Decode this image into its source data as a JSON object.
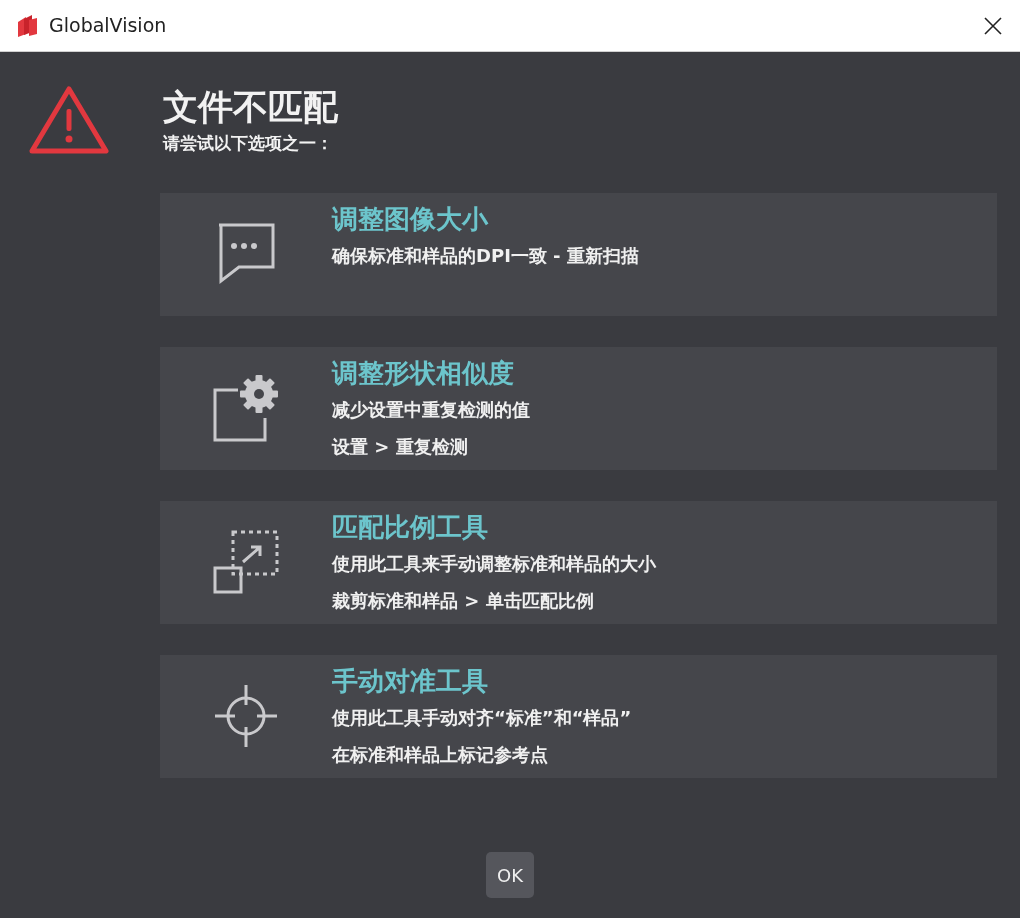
{
  "window": {
    "title": "GlobalVision"
  },
  "header": {
    "title": "文件不匹配",
    "subtitle": "请尝试以下选项之一："
  },
  "options": [
    {
      "kind": "chat",
      "title": "调整图像大小",
      "lines": [
        "确保标准和样品的DPI一致 - 重新扫描"
      ]
    },
    {
      "kind": "settings",
      "title": "调整形状相似度",
      "lines": [
        "减少设置中重复检测的值",
        "设置 > 重复检测"
      ]
    },
    {
      "kind": "scale",
      "title": "匹配比例工具",
      "lines": [
        "使用此工具来手动调整标准和样品的大小",
        "裁剪标准和样品 > 单击匹配比例"
      ]
    },
    {
      "kind": "crosshair",
      "title": "手动对准工具",
      "lines": [
        "使用此工具手动对齐“标准”和“样品”",
        "在标准和样品上标记参考点"
      ]
    }
  ],
  "buttons": [
    "OK"
  ]
}
